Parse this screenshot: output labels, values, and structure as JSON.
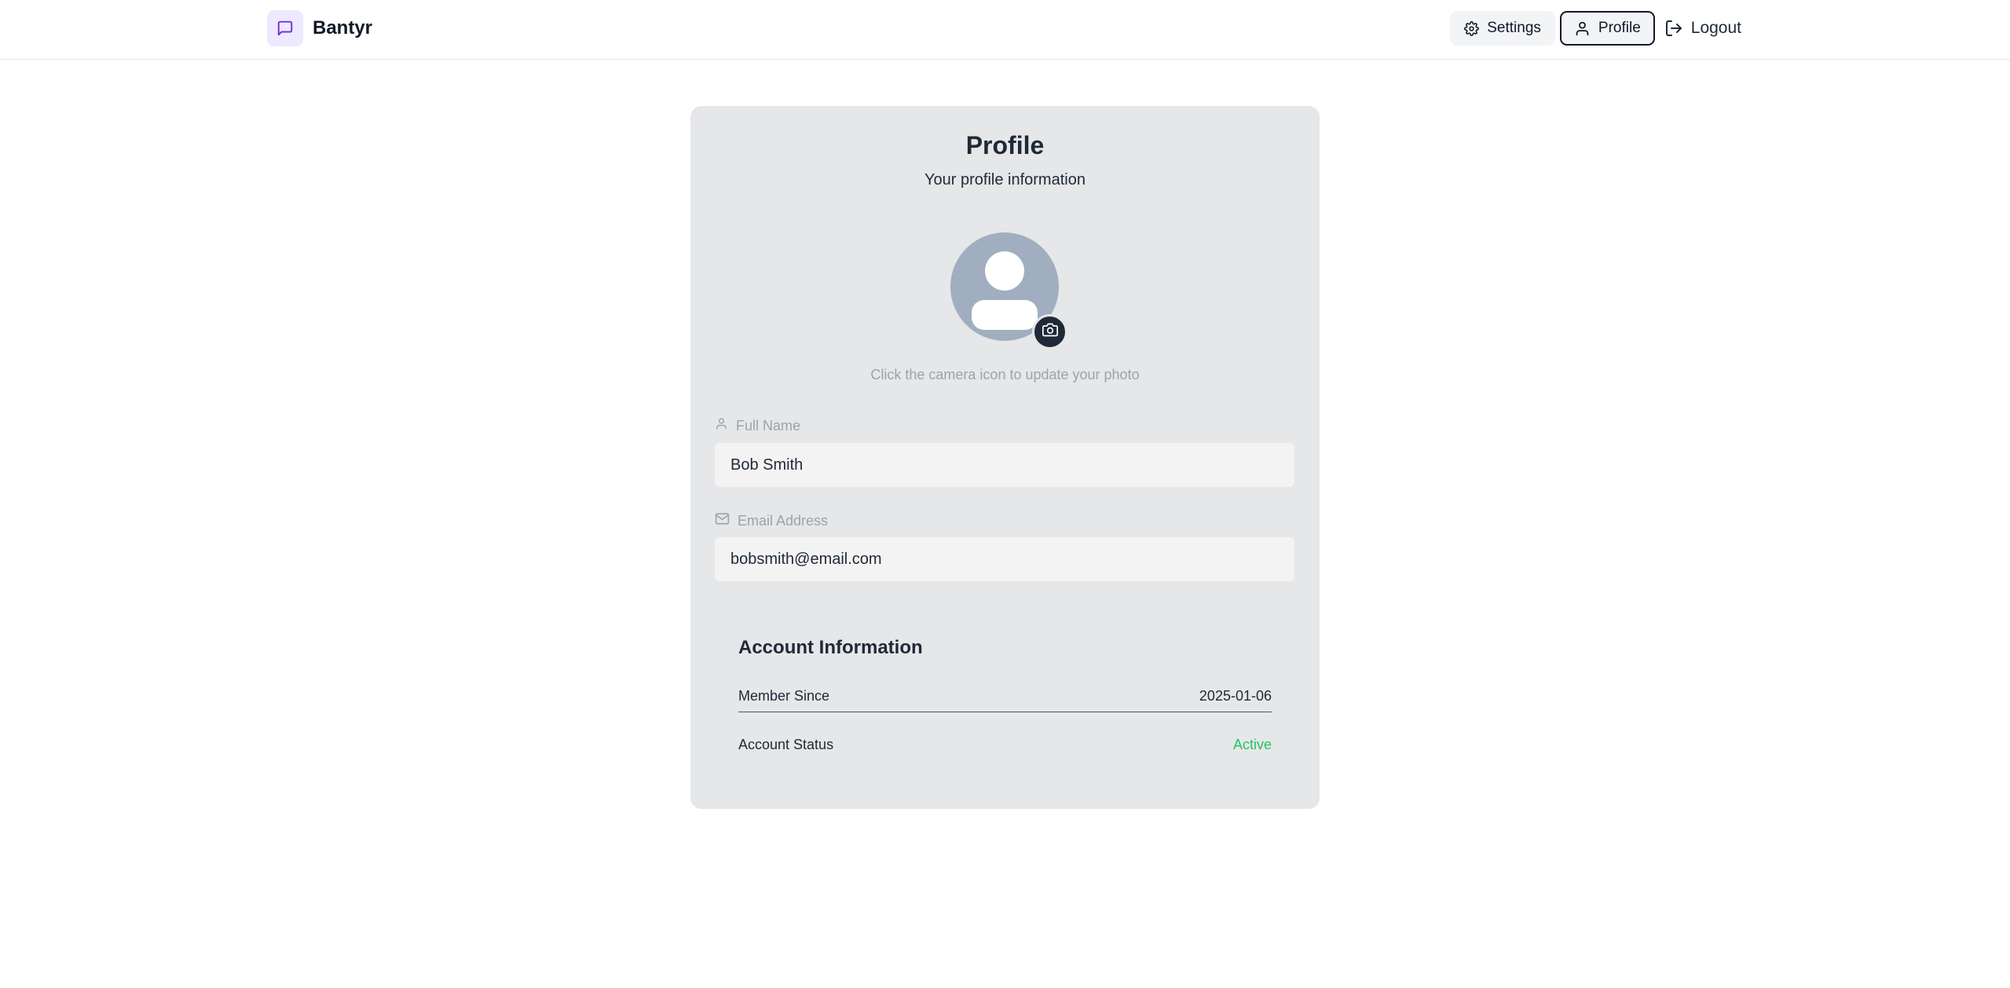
{
  "header": {
    "brand_name": "Bantyr",
    "brand_icon": "message-square-icon",
    "nav": {
      "settings_label": "Settings",
      "profile_label": "Profile",
      "logout_label": "Logout"
    }
  },
  "profile": {
    "title": "Profile",
    "subtitle": "Your profile information",
    "photo_hint": "Click the camera icon to update your photo",
    "fields": {
      "full_name": {
        "label": "Full Name",
        "value": "Bob Smith"
      },
      "email": {
        "label": "Email Address",
        "value": "bobsmith@email.com"
      }
    },
    "account": {
      "title": "Account Information",
      "member_since_label": "Member Since",
      "member_since_value": "2025-01-06",
      "status_label": "Account Status",
      "status_value": "Active"
    }
  },
  "colors": {
    "accent": "#7c3aed",
    "status_active": "#22c55e",
    "card_bg": "#e5e7e8",
    "avatar_bg": "#a0aec0"
  }
}
